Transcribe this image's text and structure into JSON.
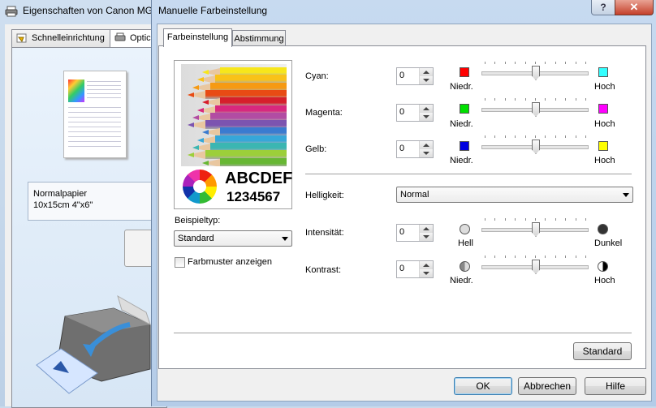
{
  "background_window": {
    "title": "Eigenschaften von Canon MG",
    "tabs": [
      {
        "label": "Schnelleinrichtung",
        "icon": "quick-setup-icon"
      },
      {
        "label": "Optic",
        "icon": "options-icon"
      }
    ],
    "media": {
      "line1": "Normalpapier",
      "line2": "10x15cm 4\"x6\""
    }
  },
  "dialog": {
    "title": "Manuelle Farbeinstellung",
    "titlebar_help": "?",
    "titlebar_close": "✕",
    "tabs": [
      {
        "label": "Farbeinstellung",
        "active": true
      },
      {
        "label": "Abstimmung",
        "active": false
      }
    ],
    "preview": {
      "logo_line1": "ABCDEF",
      "logo_line2": "1234567",
      "sample_type_label": "Beispieltyp:",
      "sample_type_value": "Standard",
      "color_pattern_label": "Farbmuster anzeigen",
      "color_pattern_checked": false
    },
    "color_balance": [
      {
        "label": "Cyan:",
        "value": "0",
        "low_color": "#ff0000",
        "low_label": "Niedr.",
        "high_color": "#33ffff",
        "high_label": "Hoch",
        "level": 0.5
      },
      {
        "label": "Magenta:",
        "value": "0",
        "low_color": "#00e000",
        "low_label": "Niedr.",
        "high_color": "#ff00ff",
        "high_label": "Hoch",
        "level": 0.5
      },
      {
        "label": "Gelb:",
        "value": "0",
        "low_color": "#0000e0",
        "low_label": "Niedr.",
        "high_color": "#ffff00",
        "high_label": "Hoch",
        "level": 0.5
      }
    ],
    "brightness": {
      "label": "Helligkeit:",
      "value": "Normal"
    },
    "intensity": {
      "label": "Intensität:",
      "value": "0",
      "low_label": "Hell",
      "high_label": "Dunkel",
      "level": 0.5
    },
    "contrast": {
      "label": "Kontrast:",
      "value": "0",
      "low_label": "Niedr.",
      "high_label": "Hoch",
      "level": 0.5
    },
    "buttons": {
      "standard": "Standard",
      "ok": "OK",
      "cancel": "Abbrechen",
      "help": "Hilfe"
    }
  }
}
